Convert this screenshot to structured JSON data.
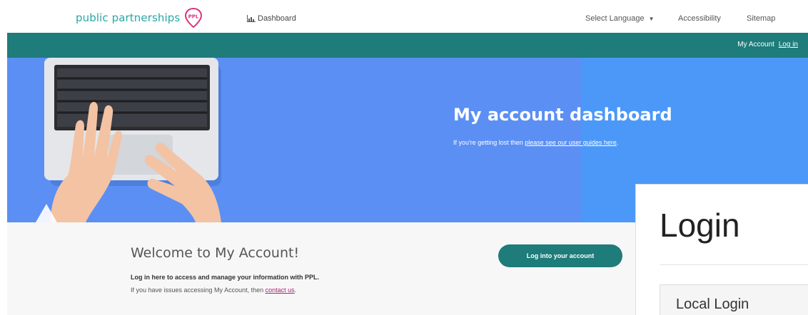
{
  "header": {
    "logo_text": "public partnerships",
    "logo_badge": "PPL",
    "nav_dashboard": "Dashboard",
    "select_language": "Select Language",
    "accessibility": "Accessibility",
    "sitemap": "Sitemap"
  },
  "account_bar": {
    "my_account": "My Account",
    "log_in": "Log in"
  },
  "hero": {
    "title": "My account dashboard",
    "subtitle_prefix": "If you're getting lost then ",
    "subtitle_link": "please see our user guides here",
    "subtitle_suffix": "."
  },
  "welcome": {
    "title": "Welcome to My Account!",
    "text": "Log in here to access and manage your information with PPL.",
    "issue_prefix": "If you have issues accessing My Account, then ",
    "issue_link": "contact us",
    "issue_suffix": ".",
    "button": "Log into your account"
  },
  "login_panel": {
    "heading": "Login",
    "local_login": "Local Login"
  },
  "colors": {
    "teal": "#1e7c7a",
    "logo_teal": "#2aa7a3",
    "hero_blue": "#5b8ff4",
    "link_magenta": "#a3286f"
  }
}
